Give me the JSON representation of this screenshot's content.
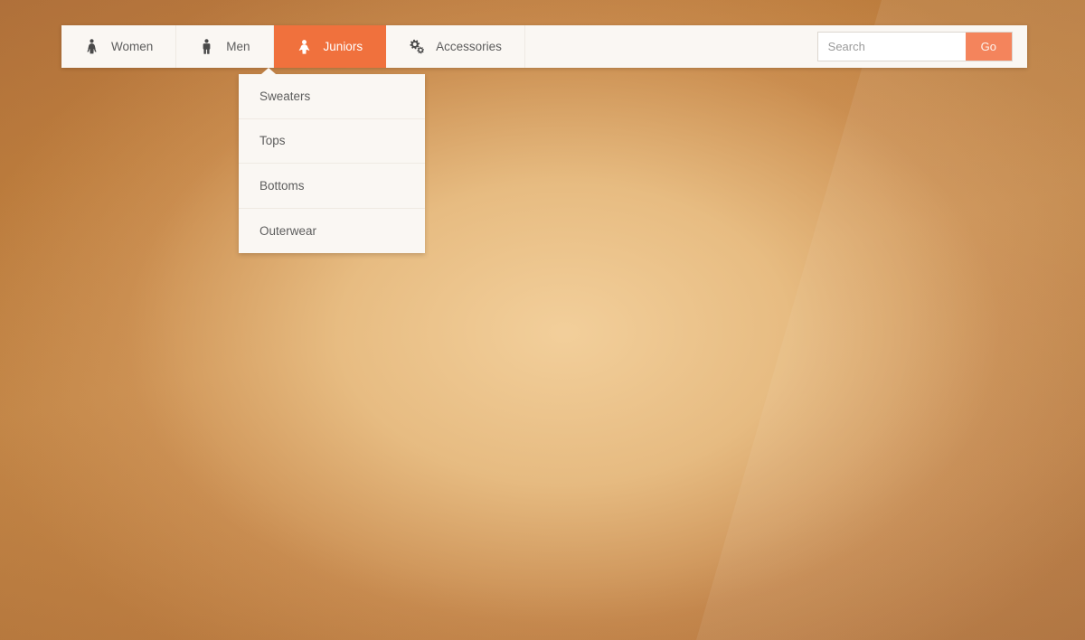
{
  "nav": {
    "items": [
      {
        "label": "Women",
        "icon": "woman-icon",
        "active": false
      },
      {
        "label": "Men",
        "icon": "man-icon",
        "active": false
      },
      {
        "label": "Juniors",
        "icon": "child-icon",
        "active": true
      },
      {
        "label": "Accessories",
        "icon": "gears-icon",
        "active": false
      }
    ]
  },
  "search": {
    "value": "",
    "placeholder": "Search",
    "button_label": "Go"
  },
  "dropdown": {
    "parent": "Juniors",
    "items": [
      {
        "label": "Sweaters"
      },
      {
        "label": "Tops"
      },
      {
        "label": "Bottoms"
      },
      {
        "label": "Outerwear"
      }
    ]
  },
  "colors": {
    "accent": "#f0713d",
    "accent_button": "#f4845c",
    "bar_background": "#faf7f3",
    "text": "#5d5d5d",
    "page_background_dark": "#b8773f",
    "page_background_light": "#edc891"
  }
}
